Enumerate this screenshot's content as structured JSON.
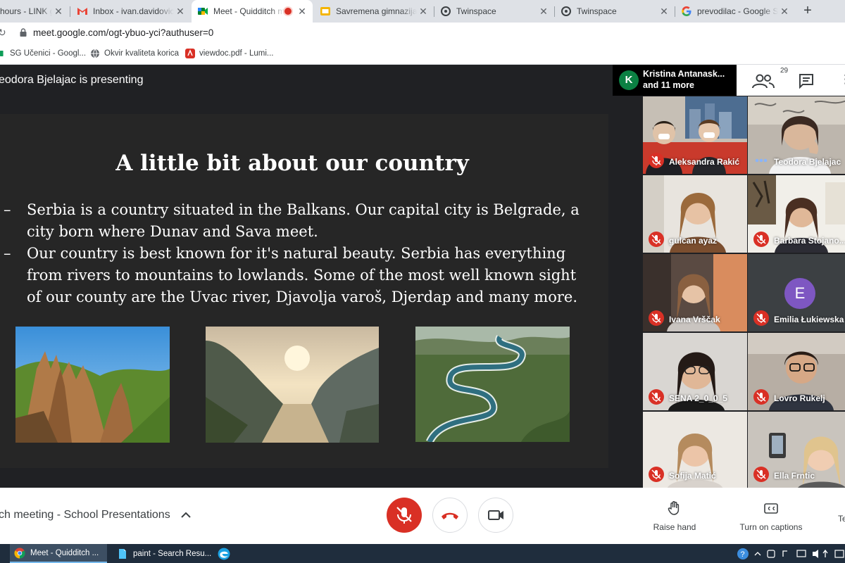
{
  "browser": {
    "tabs": [
      {
        "label": "hours - LINK g",
        "icon": "generic-page-icon"
      },
      {
        "label": "Inbox - ivan.davidovic@",
        "icon": "gmail-icon"
      },
      {
        "label": "Meet - Quidditch m",
        "icon": "meet-icon",
        "active": true,
        "recording": true
      },
      {
        "label": "Savremena gimnazija- I",
        "icon": "slides-icon"
      },
      {
        "label": "Twinspace",
        "icon": "twinspace-icon"
      },
      {
        "label": "Twinspace",
        "icon": "twinspace-icon"
      },
      {
        "label": "prevodilac - Google Sea",
        "icon": "google-icon"
      }
    ],
    "new_tab": "+",
    "close_glyph": "✕",
    "url": "meet.google.com/ogt-ybuo-yci?authuser=0",
    "bookmarks": [
      {
        "label": "SG Učenici - Googl...",
        "icon": "sheets-icon"
      },
      {
        "label": "Okvir kvaliteta korica",
        "icon": "globe-icon"
      },
      {
        "label": "viewdoc.pdf - Lumi...",
        "icon": "pdf-icon"
      }
    ]
  },
  "meet": {
    "presenting_text": "eodora Bjelajac is presenting",
    "presenter": {
      "initial": "K",
      "name": "Kristina Antanask...",
      "more": "and 11 more"
    },
    "participant_count": "29",
    "slide": {
      "title": "A little bit about our country",
      "bullets": [
        "Serbia is a country situated in the Balkans. Our capital city is Belgrade, a city born where Dunav and Sava meet.",
        "Our country is best known for it's natural beauty. Serbia has everything from rivers to mountains to lowlands. Some of the most well known sight of our county are the Uvac river, Djavolja varoš, Djerdap and many more."
      ],
      "bullet_marker": "–"
    },
    "participants": [
      {
        "name": "Aleksandra Rakić",
        "muted": true
      },
      {
        "name": "Teodora Bjelajac",
        "muted": false,
        "speaking": true
      },
      {
        "name": "gulcan ayaz",
        "muted": true
      },
      {
        "name": "Barbara Stojano...",
        "muted": true
      },
      {
        "name": "Ivana Vrščak",
        "muted": true
      },
      {
        "name": "Emilia Łukiewska",
        "muted": true,
        "avatar_initial": "E",
        "avatar_color": "#7e57c2"
      },
      {
        "name": "SENA 2_0_0_5",
        "muted": true
      },
      {
        "name": "Lovro Rukelj",
        "muted": true
      },
      {
        "name": "Sofija Matić",
        "muted": true
      },
      {
        "name": "Ella Frntic",
        "muted": true
      }
    ],
    "meeting_title": "ch meeting - School Presentations",
    "controls": {
      "raise_hand": "Raise hand",
      "captions": "Turn on captions",
      "edge_label": "Te"
    }
  },
  "taskbar": {
    "items": [
      {
        "label": "Meet - Quidditch ...",
        "icon": "chrome-icon",
        "active": true
      },
      {
        "label": "paint - Search Resu...",
        "icon": "file-icon"
      },
      {
        "label": "",
        "icon": "edge-icon"
      }
    ]
  },
  "colors": {
    "meet_red": "#d93025",
    "dark_bg": "#202124",
    "slide_bg": "#262626",
    "taskbar": "#1f2d3d"
  }
}
